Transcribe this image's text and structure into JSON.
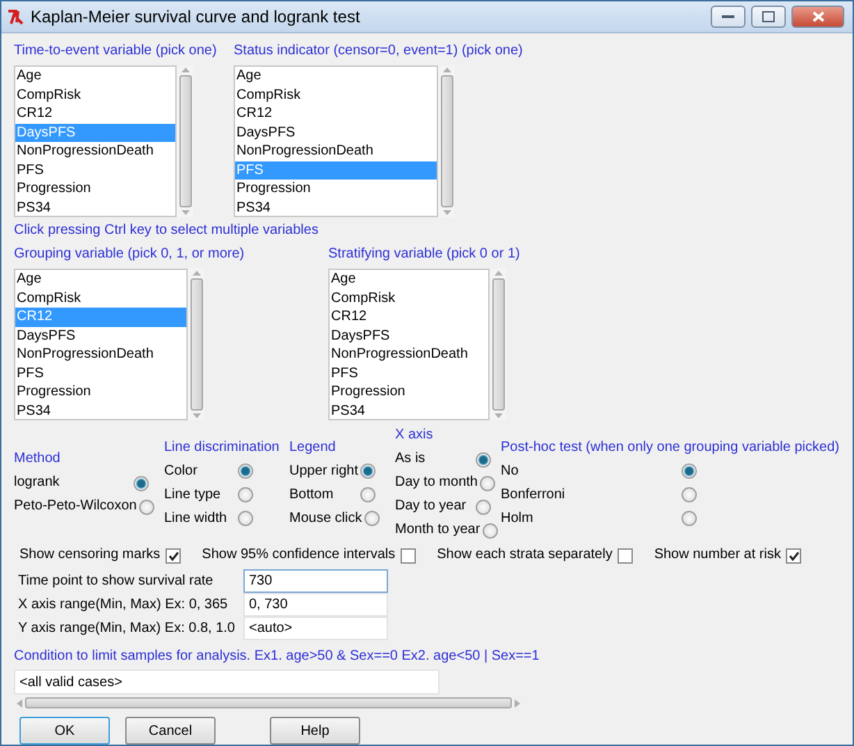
{
  "window": {
    "title": "Kaplan-Meier survival curve and logrank test"
  },
  "top_lists": [
    {
      "label": "Time-to-event variable (pick one)",
      "items": [
        {
          "label": "Age",
          "selected": false
        },
        {
          "label": "CompRisk",
          "selected": false
        },
        {
          "label": "CR12",
          "selected": false
        },
        {
          "label": "DaysPFS",
          "selected": true
        },
        {
          "label": "NonProgressionDeath",
          "selected": false
        },
        {
          "label": "PFS",
          "selected": false
        },
        {
          "label": "Progression",
          "selected": false
        },
        {
          "label": "PS34",
          "selected": false
        }
      ]
    },
    {
      "label": "Status indicator (censor=0, event=1) (pick one)",
      "items": [
        {
          "label": "Age",
          "selected": false
        },
        {
          "label": "CompRisk",
          "selected": false
        },
        {
          "label": "CR12",
          "selected": false
        },
        {
          "label": "DaysPFS",
          "selected": false
        },
        {
          "label": "NonProgressionDeath",
          "selected": false
        },
        {
          "label": "PFS",
          "selected": true
        },
        {
          "label": "Progression",
          "selected": false
        },
        {
          "label": "PS34",
          "selected": false
        }
      ]
    }
  ],
  "hint": "Click pressing Ctrl key to select multiple variables",
  "bottom_lists": [
    {
      "label": "Grouping variable (pick 0, 1, or more)",
      "items": [
        {
          "label": "Age",
          "selected": false
        },
        {
          "label": "CompRisk",
          "selected": false
        },
        {
          "label": "CR12",
          "selected": true
        },
        {
          "label": "DaysPFS",
          "selected": false
        },
        {
          "label": "NonProgressionDeath",
          "selected": false
        },
        {
          "label": "PFS",
          "selected": false
        },
        {
          "label": "Progression",
          "selected": false
        },
        {
          "label": "PS34",
          "selected": false
        }
      ]
    },
    {
      "label": "Stratifying variable (pick 0 or 1)",
      "items": [
        {
          "label": "Age",
          "selected": false
        },
        {
          "label": "CompRisk",
          "selected": false
        },
        {
          "label": "CR12",
          "selected": false
        },
        {
          "label": "DaysPFS",
          "selected": false
        },
        {
          "label": "NonProgressionDeath",
          "selected": false
        },
        {
          "label": "PFS",
          "selected": false
        },
        {
          "label": "Progression",
          "selected": false
        },
        {
          "label": "PS34",
          "selected": false
        }
      ]
    }
  ],
  "option_groups": [
    {
      "title": "Method",
      "options": [
        {
          "label": "logrank",
          "selected": true
        },
        {
          "label": "Peto-Peto-Wilcoxon",
          "selected": false
        }
      ]
    },
    {
      "title": "Line discrimination",
      "options": [
        {
          "label": "Color",
          "selected": true
        },
        {
          "label": "Line type",
          "selected": false
        },
        {
          "label": "Line width",
          "selected": false
        }
      ]
    },
    {
      "title": "Legend",
      "options": [
        {
          "label": "Upper right",
          "selected": true
        },
        {
          "label": "Bottom",
          "selected": false
        },
        {
          "label": "Mouse click",
          "selected": false
        }
      ]
    },
    {
      "title": "X axis",
      "options": [
        {
          "label": "As is",
          "selected": true
        },
        {
          "label": "Day to month",
          "selected": false
        },
        {
          "label": "Day to year",
          "selected": false
        },
        {
          "label": "Month to year",
          "selected": false
        }
      ]
    },
    {
      "title": "Post-hoc test (when only one grouping variable picked)",
      "options": [
        {
          "label": "No",
          "selected": true
        },
        {
          "label": "Bonferroni",
          "selected": false
        },
        {
          "label": "Holm",
          "selected": false
        }
      ]
    }
  ],
  "checkboxes": [
    {
      "label": "Show censoring marks",
      "checked": true
    },
    {
      "label": "Show 95% confidence intervals",
      "checked": false
    },
    {
      "label": "Show each strata separately",
      "checked": false
    },
    {
      "label": "Show number at risk",
      "checked": true
    }
  ],
  "fields": [
    {
      "label": "Time point to show survival rate",
      "value": "730",
      "focused": true
    },
    {
      "label": "X axis range(Min, Max) Ex: 0, 365",
      "value": "0, 730",
      "focused": false
    },
    {
      "label": "Y axis range(Min, Max) Ex: 0.8, 1.0",
      "value": "<auto>",
      "focused": false
    }
  ],
  "condition": {
    "label": "Condition to limit samples for analysis. Ex1. age>50 & Sex==0  Ex2. age<50 | Sex==1",
    "value": "<all valid cases>"
  },
  "buttons": [
    {
      "label": "OK",
      "focused": true
    },
    {
      "label": "Cancel",
      "focused": false
    },
    {
      "label": "Help",
      "focused": false
    }
  ]
}
